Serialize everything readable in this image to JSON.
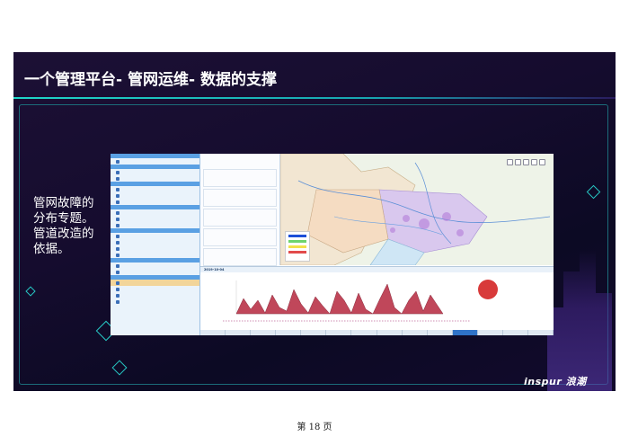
{
  "slide": {
    "title": "一个管理平台- 管网运维- 数据的支撑",
    "description_lines": [
      "管网故障的",
      "分布专题。",
      "管道改造的",
      "依据。"
    ],
    "logo": "inspur 浪潮",
    "page_label": "第 18 页"
  },
  "app": {
    "chart_date": "2019-10-04",
    "colors": {
      "header": "#5aa0e3",
      "selected": "#f2d59a",
      "active_tab": "#2f73c8",
      "fill": "#c0475a"
    }
  }
}
